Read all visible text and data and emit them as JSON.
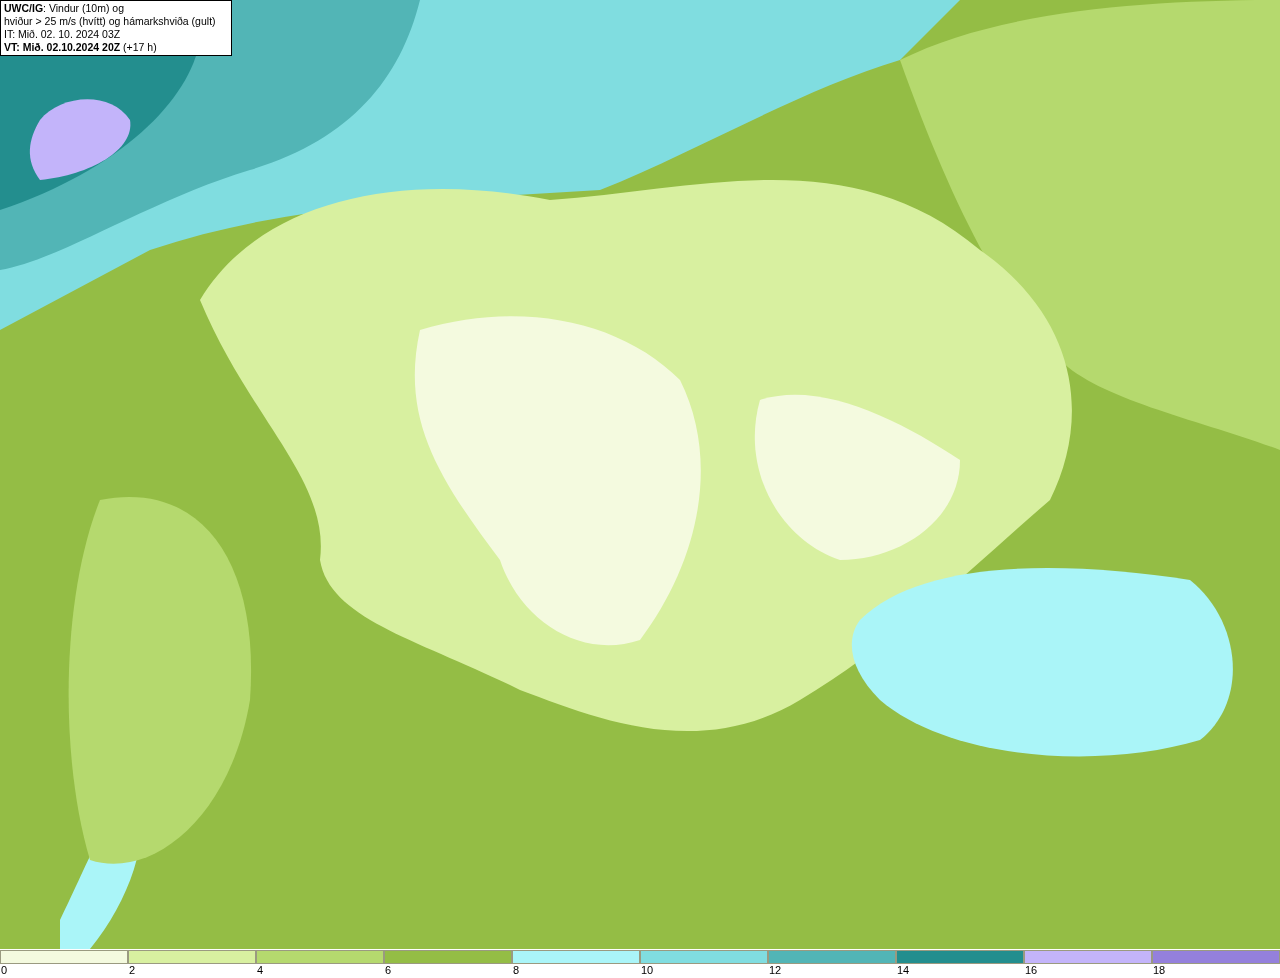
{
  "title_box": {
    "lines": [
      "**UWC/IG**: Vindur (10m) og",
      "hviður > 25 m/s (hvítt) og hámarkshviða (gult)",
      "IT: Mið. 02. 10. 2024 03Z",
      "**VT: Mið. 02.10.2024 20Z** (+17 h)"
    ]
  },
  "legend": {
    "bins": [
      {
        "label": "0",
        "color": "#f4fadf"
      },
      {
        "label": "2",
        "color": "#d8f0a0"
      },
      {
        "label": "4",
        "color": "#b5d96e"
      },
      {
        "label": "6",
        "color": "#94bd45"
      },
      {
        "label": "8",
        "color": "#aaf5f8"
      },
      {
        "label": "10",
        "color": "#80dde0"
      },
      {
        "label": "12",
        "color": "#52b5b6"
      },
      {
        "label": "14",
        "color": "#238e8e"
      },
      {
        "label": "16",
        "color": "#c3b4fa"
      },
      {
        "label": "18",
        "color": "#9480dc"
      }
    ]
  }
}
